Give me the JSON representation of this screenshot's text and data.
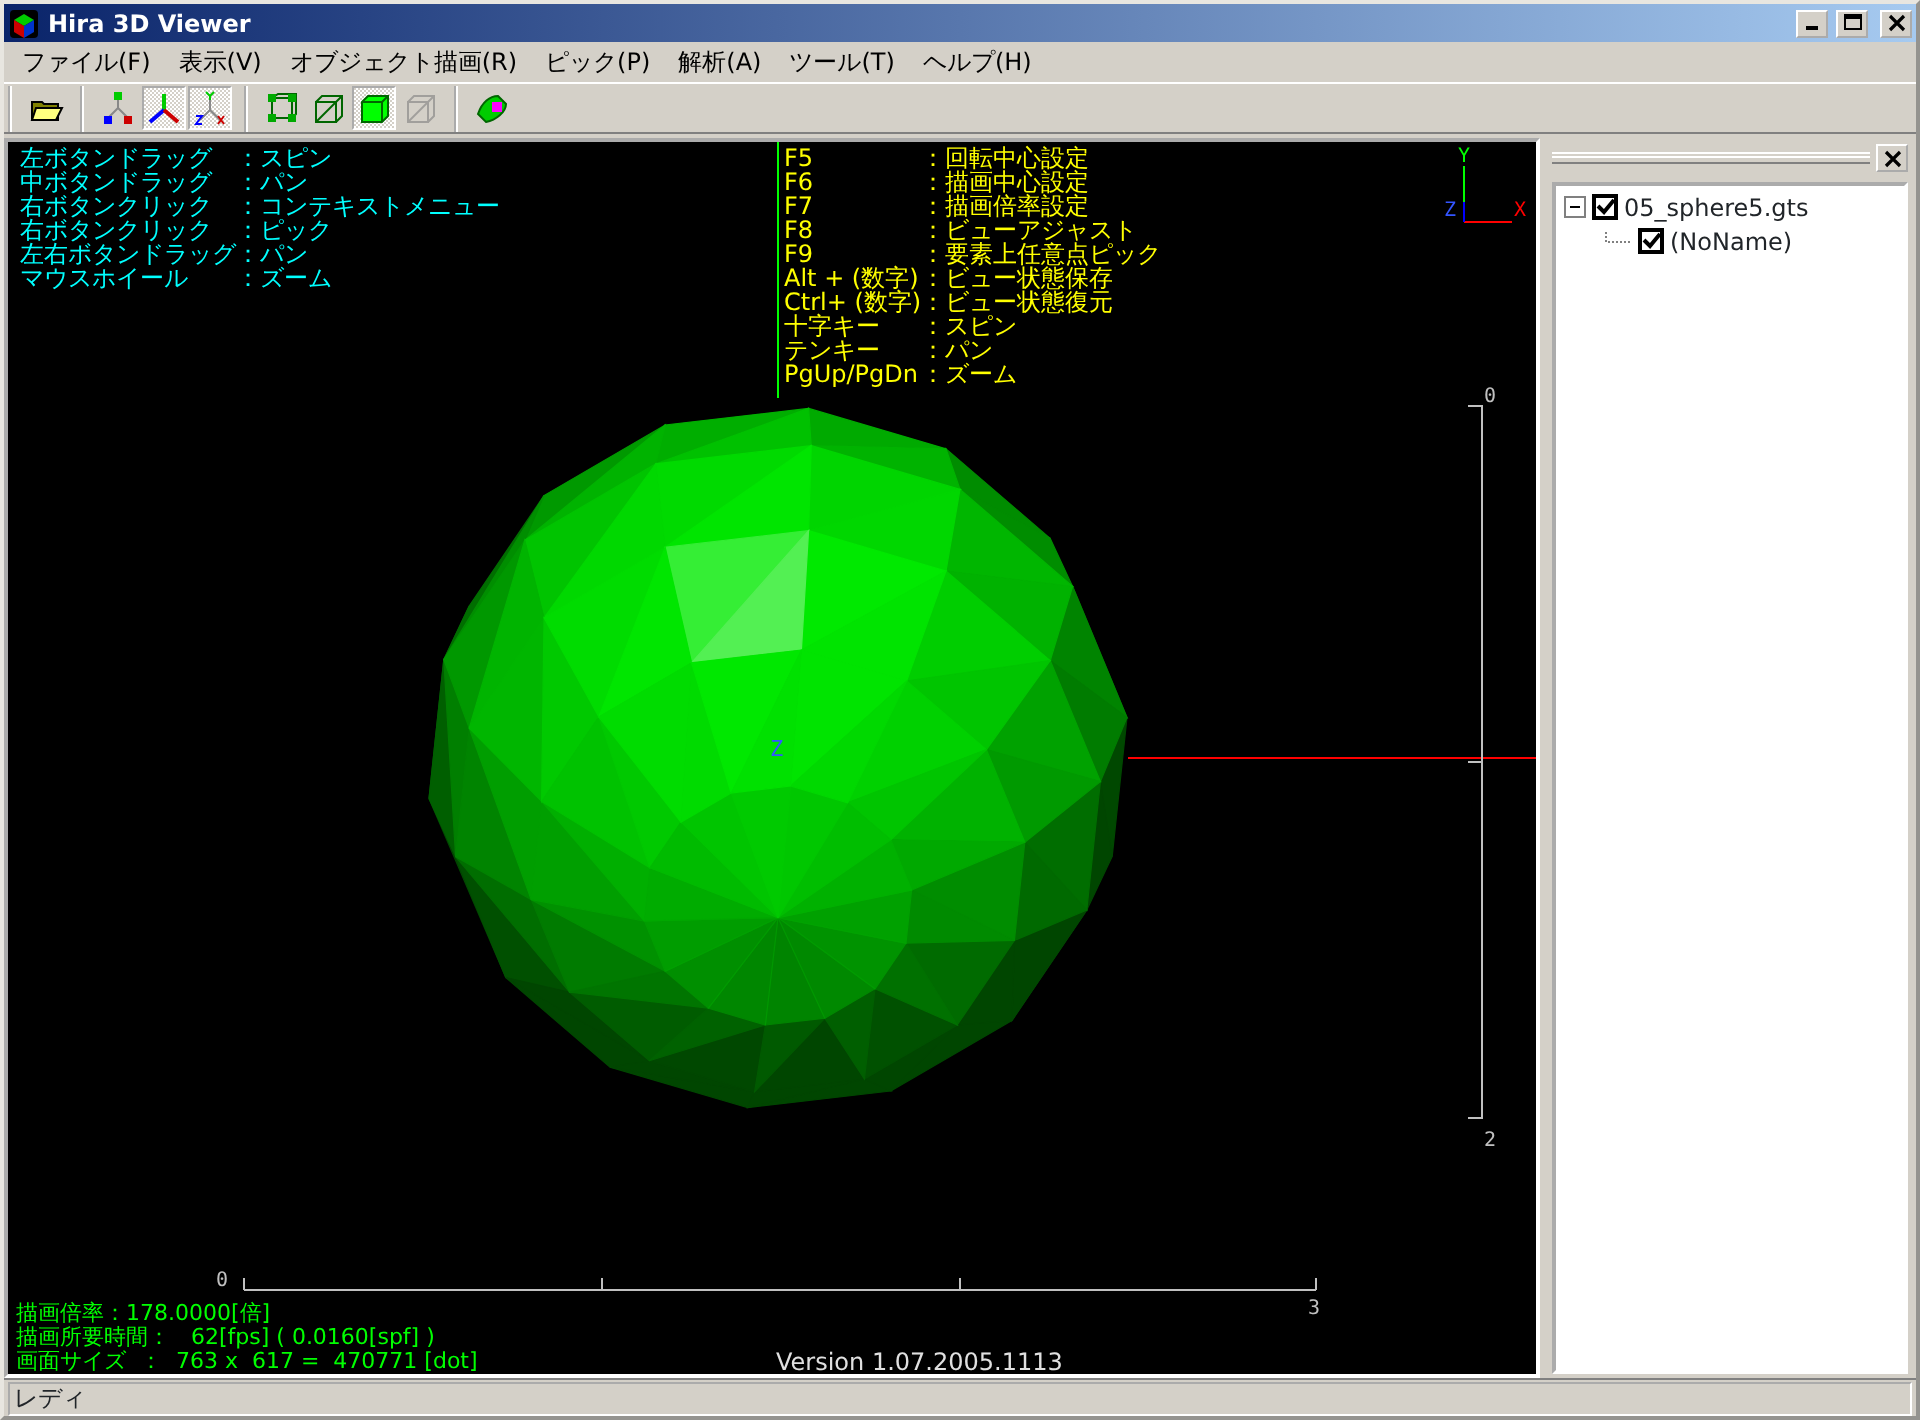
{
  "window": {
    "title": "Hira 3D Viewer"
  },
  "menu": [
    "ファイル(F)",
    "表示(V)",
    "オブジェクト描画(R)",
    "ピック(P)",
    "解析(A)",
    "ツール(T)",
    "ヘルプ(H)"
  ],
  "toolbar_groups": [
    [
      {
        "kind": "open",
        "pressed": false,
        "disabled": false
      }
    ],
    [
      {
        "kind": "axes-small",
        "pressed": false,
        "disabled": false
      },
      {
        "kind": "axes",
        "pressed": true,
        "disabled": false
      },
      {
        "kind": "axes-xyz",
        "pressed": true,
        "disabled": false
      }
    ],
    [
      {
        "kind": "wire-nodes",
        "pressed": false,
        "disabled": false
      },
      {
        "kind": "wire-box",
        "pressed": false,
        "disabled": false
      },
      {
        "kind": "solid-box",
        "pressed": true,
        "disabled": false
      },
      {
        "kind": "wire-box",
        "pressed": false,
        "disabled": true
      }
    ],
    [
      {
        "kind": "paint",
        "pressed": false,
        "disabled": false
      }
    ]
  ],
  "viewport": {
    "mouse_help": [
      {
        "key": "左ボタンドラッグ",
        "action": "：スピン"
      },
      {
        "key": "中ボタンドラッグ",
        "action": "：パン"
      },
      {
        "key": "右ボタンクリック",
        "action": "：コンテキストメニュー"
      },
      {
        "key": "右ボタンクリック",
        "action": "：ピック"
      },
      {
        "key": "左右ボタンドラッグ",
        "action": "：パン"
      },
      {
        "key": "マウスホイール",
        "action": "：ズーム"
      }
    ],
    "key_help": [
      {
        "key": "F5",
        "action": "：回転中心設定"
      },
      {
        "key": "F6",
        "action": "：描画中心設定"
      },
      {
        "key": "F7",
        "action": "：描画倍率設定"
      },
      {
        "key": "F8",
        "action": "：ビューアジャスト"
      },
      {
        "key": "F9",
        "action": "：要素上任意点ピック"
      },
      {
        "key": "Alt + (数字)",
        "action": "：ビュー状態保存"
      },
      {
        "key": "Ctrl+ (数字)",
        "action": "：ビュー状態復元"
      },
      {
        "key": "十字キー",
        "action": "：スピン"
      },
      {
        "key": "テンキー",
        "action": "：パン"
      },
      {
        "key": "PgUp/PgDn",
        "action": "：ズーム"
      }
    ],
    "triad": {
      "y": "Y",
      "z": "Z",
      "x": "X"
    },
    "center_label": "Z",
    "vertical_scale": [
      "0",
      "2"
    ],
    "horizontal_scale": [
      "0",
      "3"
    ],
    "stats": [
      "描画倍率：178.0000[倍]",
      "描画所要時間：   62[fps] ( 0.0160[spf] )",
      "画面サイズ  ：  763 x  617 =  470771 [dot]"
    ],
    "version": "Version 1.07.2005.1113"
  },
  "tree": [
    {
      "label": "05_sphere5.gts",
      "checked": true,
      "expanded": true,
      "children": [
        {
          "label": "(NoName)",
          "checked": true
        }
      ]
    }
  ],
  "status_bar": "レディ"
}
